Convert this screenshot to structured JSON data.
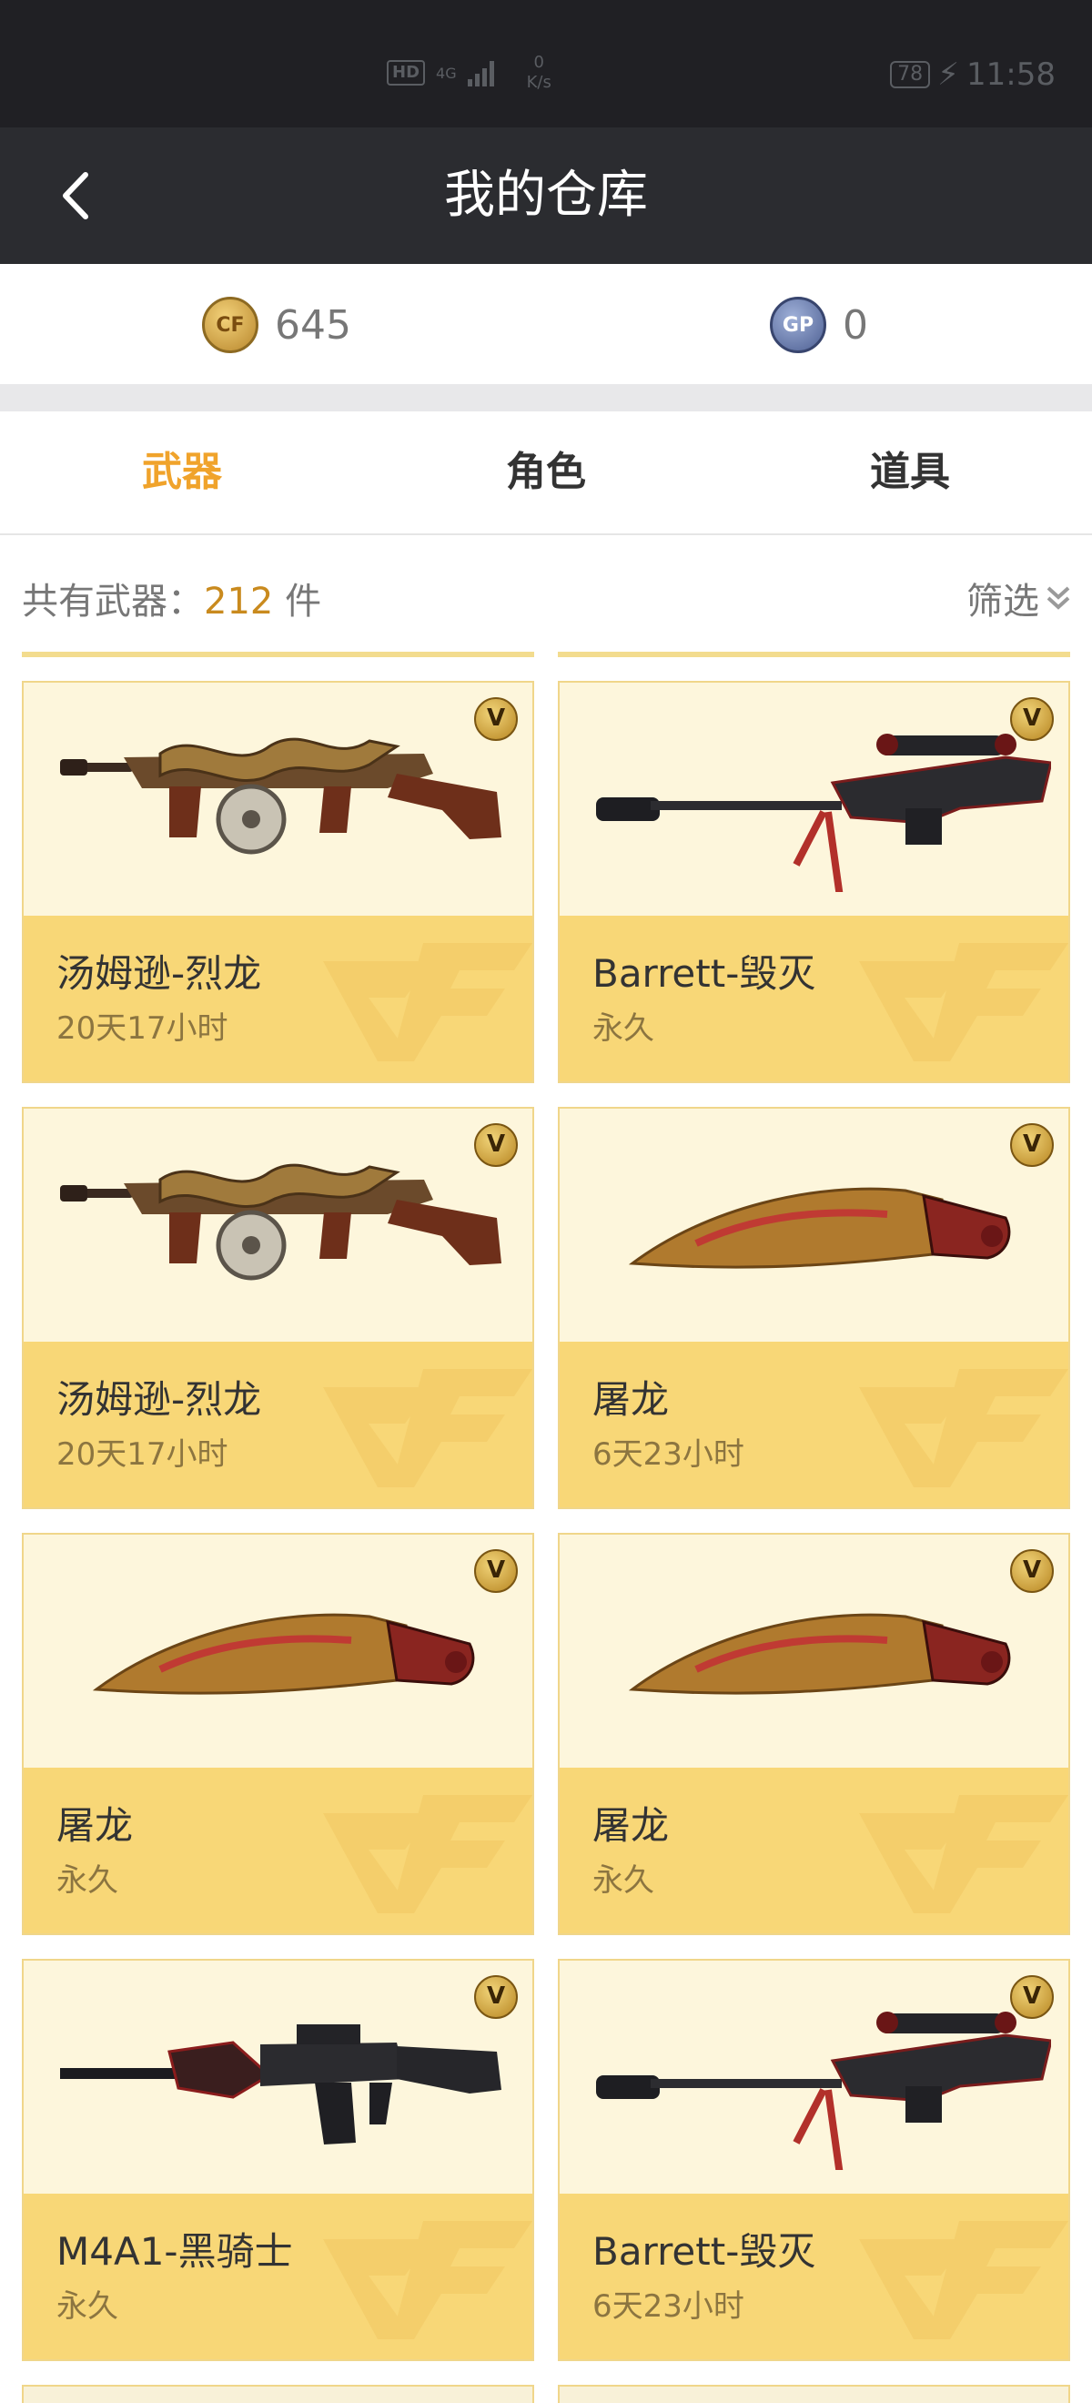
{
  "status": {
    "hd": "HD",
    "net": "4G",
    "speed_value": "0",
    "speed_unit": "K/s",
    "battery": "78",
    "time": "11:58"
  },
  "header": {
    "title": "我的仓库",
    "back_icon": "chevron-left-icon"
  },
  "currency": [
    {
      "icon": "cf-coin-icon",
      "label": "CF",
      "value": "645"
    },
    {
      "icon": "gp-coin-icon",
      "label": "GP",
      "value": "0"
    }
  ],
  "tabs": [
    {
      "label": "武器",
      "active": true
    },
    {
      "label": "角色",
      "active": false
    },
    {
      "label": "道具",
      "active": false
    }
  ],
  "summary": {
    "prefix": "共有武器：",
    "count": "212",
    "suffix": " 件",
    "filter": "筛选"
  },
  "items": [
    {
      "name": "汤姆逊-烈龙",
      "duration": "20天17小时",
      "weapon": "thompson"
    },
    {
      "name": "Barrett-毁灭",
      "duration": "永久",
      "weapon": "sniper"
    },
    {
      "name": "汤姆逊-烈龙",
      "duration": "20天17小时",
      "weapon": "thompson"
    },
    {
      "name": "屠龙",
      "duration": "6天23小时",
      "weapon": "knife"
    },
    {
      "name": "屠龙",
      "duration": "永久",
      "weapon": "knife"
    },
    {
      "name": "屠龙",
      "duration": "永久",
      "weapon": "knife"
    },
    {
      "name": "M4A1-黑骑士",
      "duration": "永久",
      "weapon": "rifle"
    },
    {
      "name": "Barrett-毁灭",
      "duration": "6天23小时",
      "weapon": "sniper"
    }
  ],
  "colors": {
    "accent": "#f0a32b",
    "card_top": "#fdf6dc",
    "card_bottom": "#f8d777",
    "header_bg": "#2b2c30"
  }
}
